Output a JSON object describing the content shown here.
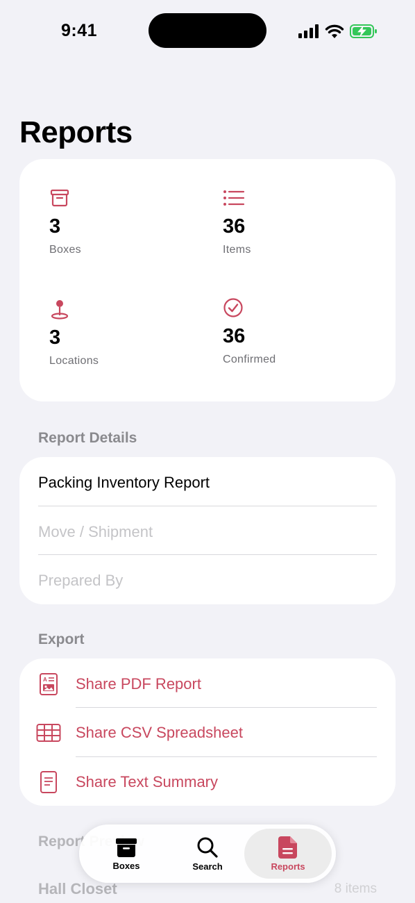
{
  "status_bar": {
    "time": "9:41"
  },
  "page": {
    "title": "Reports"
  },
  "stats": [
    {
      "value": "3",
      "label": "Boxes",
      "icon": "archive-box-icon"
    },
    {
      "value": "36",
      "label": "Items",
      "icon": "list-icon"
    },
    {
      "value": "3",
      "label": "Locations",
      "icon": "map-pin-icon"
    },
    {
      "value": "36",
      "label": "Confirmed",
      "icon": "checkmark-circle-icon"
    }
  ],
  "report_details": {
    "header": "Report Details",
    "title_value": "Packing Inventory Report",
    "move_placeholder": "Move / Shipment",
    "prepared_by_placeholder": "Prepared By"
  },
  "export": {
    "header": "Export",
    "items": [
      {
        "label": "Share PDF Report",
        "icon": "pdf-document-icon"
      },
      {
        "label": "Share CSV Spreadsheet",
        "icon": "spreadsheet-icon"
      },
      {
        "label": "Share Text Summary",
        "icon": "text-document-icon"
      }
    ]
  },
  "report_preview": {
    "header": "Report Preview",
    "row_name": "Hall Closet",
    "row_count": "8 items"
  },
  "tab_bar": {
    "tabs": [
      {
        "label": "Boxes",
        "icon": "archive-box-icon"
      },
      {
        "label": "Search",
        "icon": "magnifier-icon"
      },
      {
        "label": "Reports",
        "icon": "document-icon"
      }
    ],
    "active": "Reports"
  },
  "colors": {
    "accent": "#c8475e",
    "background": "#f2f2f7",
    "battery": "#34c759"
  }
}
